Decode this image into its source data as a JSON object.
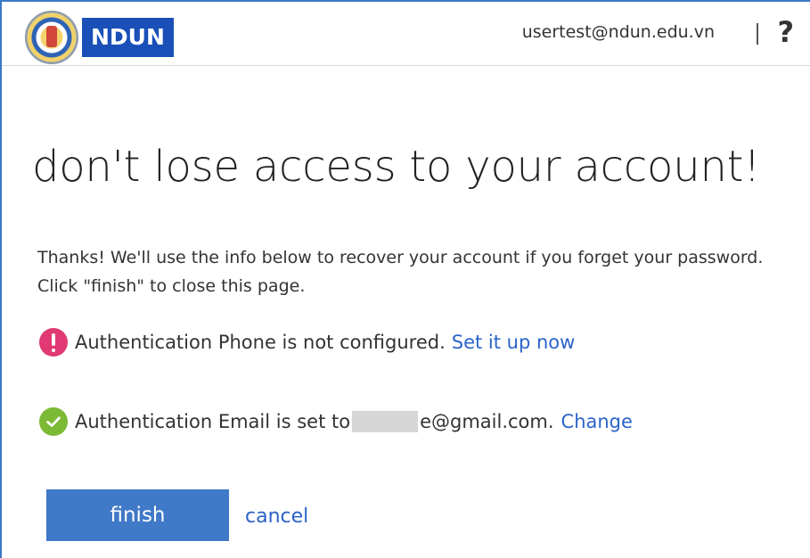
{
  "header": {
    "brand": "NDUN",
    "account": "usertest@ndun.edu.vn",
    "separator": "|",
    "help_label": "?"
  },
  "title": "don't lose access to your account!",
  "intro": "Thanks! We'll use the info below to recover your account if you forget your password. Click \"finish\" to close this page.",
  "phone": {
    "status_text": "Authentication Phone is not configured.",
    "action_label": "Set it up now",
    "status": "not-configured"
  },
  "email": {
    "status_prefix": "Authentication Email is set to",
    "value_suffix": "e@gmail.com.",
    "action_label": "Change",
    "status": "configured"
  },
  "buttons": {
    "finish": "finish",
    "cancel": "cancel"
  },
  "colors": {
    "accent": "#3f79c7",
    "brand": "#1a4fb8",
    "link": "#2b63c9",
    "warning": "#e03973",
    "success": "#7cb935"
  }
}
